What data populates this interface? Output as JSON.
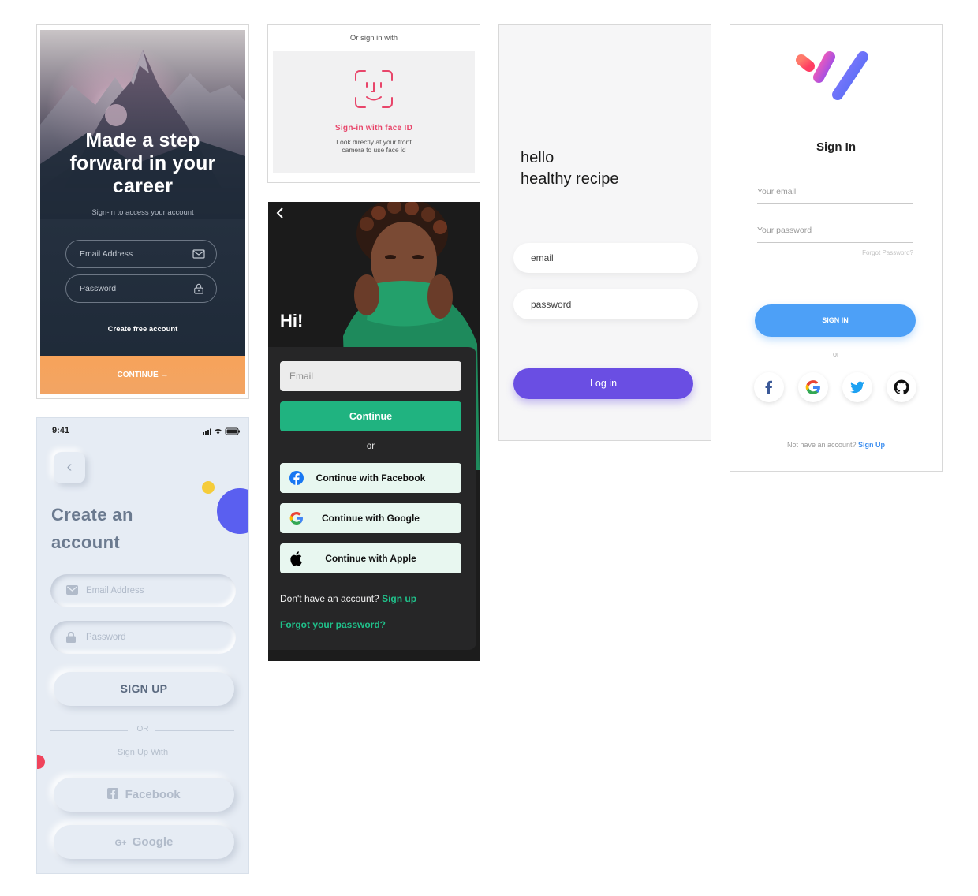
{
  "career": {
    "title": "Made a step forward in your career",
    "subtitle": "Sign-in to access your account",
    "email_placeholder": "Email Address",
    "password_placeholder": "Password",
    "create_account": "Create free account",
    "continue": "CONTINUE →"
  },
  "faceid": {
    "or_sign_in": "Or sign in with",
    "title": "Sign-in with face ID",
    "description_1": "Look directly at your front",
    "description_2": "camera to use face id"
  },
  "hi": {
    "back": "‹",
    "greeting": "Hi!",
    "email_placeholder": "Email",
    "continue": "Continue",
    "or": "or",
    "facebook": "Continue with Facebook",
    "google": "Continue with Google",
    "apple": "Continue with Apple",
    "no_account": "Don't have an account?",
    "sign_up": "Sign up",
    "forgot": "Forgot your password?",
    "accent_color": "#20b380"
  },
  "recipe": {
    "line1": "hello",
    "line2": "healthy recipe",
    "email_placeholder": "email",
    "password_placeholder": "password",
    "login": "Log in",
    "accent_color": "#6a4ee3"
  },
  "signin": {
    "title": "Sign In",
    "email_placeholder": "Your email",
    "password_placeholder": "Your password",
    "forgot": "Forgot Password?",
    "button": "SIGN IN",
    "or": "or",
    "no_account": "Not have an account?",
    "sign_up": "Sign Up",
    "social_icons": [
      "facebook-icon",
      "google-icon",
      "twitter-icon",
      "github-icon"
    ],
    "accent_color": "#4da0f7"
  },
  "create": {
    "time": "9:41",
    "title_line1": "Create an",
    "title_line2": "account",
    "email_placeholder": "Email Address",
    "password_placeholder": "Password",
    "sign_up": "SIGN UP",
    "or": "OR",
    "sign_up_with": "Sign Up With",
    "facebook": "Facebook",
    "google": "Google"
  }
}
